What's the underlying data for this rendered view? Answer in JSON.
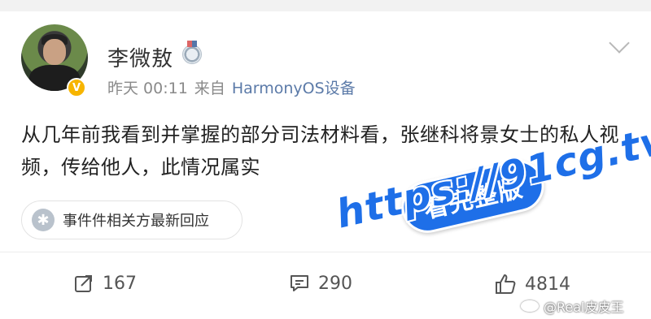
{
  "post": {
    "username": "李微敖",
    "time": "昨天 00:11",
    "source_prefix": "来自",
    "source_name": "HarmonyOS设备",
    "content": "从几年前我看到并掌握的部分司法材料看，张继科将景女士的私人视频，传给他人，此情况属实",
    "topic_label": "事件件相关方最新回应"
  },
  "icons": {
    "verified": "V",
    "medal": "medal-icon",
    "chevron": "chevron-down-icon",
    "repost": "repost-icon",
    "comment": "comment-icon",
    "like": "thumbs-up-icon",
    "topic": "topic-icon"
  },
  "actions": {
    "repost_count": "167",
    "comment_count": "290",
    "like_count": "4814"
  },
  "watermark": {
    "pill": "看完整版",
    "url": "https://91cg.tv"
  },
  "credit": "@Real皮皮王",
  "colors": {
    "accent": "#1e6fe8",
    "source_link": "#5b7aa8",
    "verified": "#f7b500"
  }
}
